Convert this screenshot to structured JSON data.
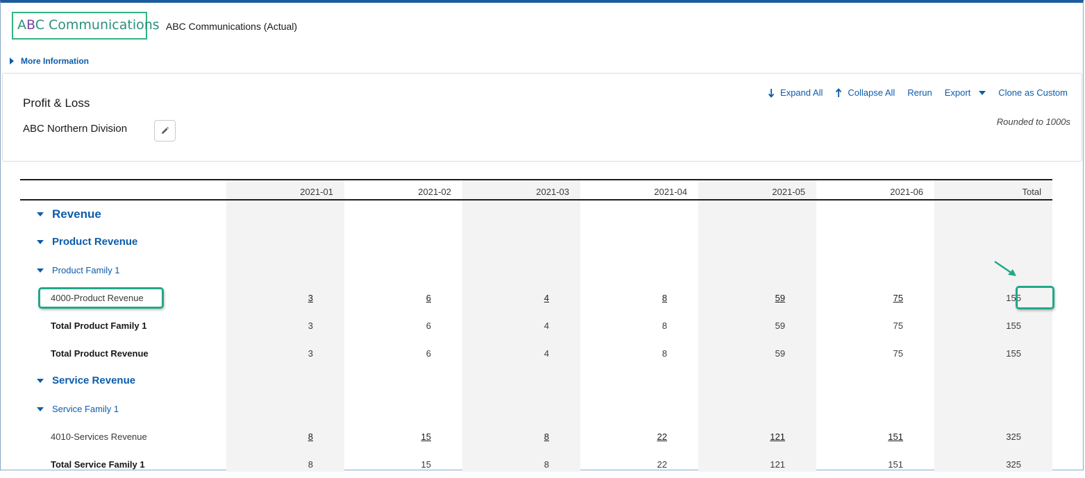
{
  "header": {
    "logo_text": "ABC Communications",
    "company_title": "ABC Communications (Actual)",
    "more_info": "More Information"
  },
  "report": {
    "title": "Profit & Loss",
    "subtitle": "ABC Northern Division",
    "rounded_note": "Rounded to 1000s",
    "actions": {
      "expand_all": "Expand All",
      "collapse_all": "Collapse All",
      "rerun": "Rerun",
      "export": "Export",
      "clone": "Clone as Custom"
    }
  },
  "table": {
    "columns": [
      "2021-01",
      "2021-02",
      "2021-03",
      "2021-04",
      "2021-05",
      "2021-06",
      "Total"
    ],
    "rows": [
      {
        "label": "Revenue",
        "level": "lvl0",
        "values": []
      },
      {
        "label": "Product Revenue",
        "level": "lvl1",
        "values": []
      },
      {
        "label": "Product Family 1",
        "level": "lvl2",
        "values": []
      },
      {
        "label": "4000-Product Revenue",
        "level": "acct",
        "values": [
          "3",
          "6",
          "4",
          "8",
          "59",
          "75",
          "155"
        ]
      },
      {
        "label": "Total Product Family 1",
        "level": "tot",
        "values": [
          "3",
          "6",
          "4",
          "8",
          "59",
          "75",
          "155"
        ]
      },
      {
        "label": "Total Product Revenue",
        "level": "tot",
        "values": [
          "3",
          "6",
          "4",
          "8",
          "59",
          "75",
          "155"
        ]
      },
      {
        "label": "Service Revenue",
        "level": "lvl1",
        "values": []
      },
      {
        "label": "Service Family 1",
        "level": "lvl2",
        "values": []
      },
      {
        "label": "4010-Services Revenue",
        "level": "acct",
        "values": [
          "8",
          "15",
          "8",
          "22",
          "121",
          "151",
          "325"
        ]
      },
      {
        "label": "Total Service Family 1",
        "level": "tot",
        "values": [
          "8",
          "15",
          "8",
          "22",
          "121",
          "151",
          "325"
        ]
      }
    ]
  },
  "colors": {
    "link": "#0b5cab",
    "highlight": "#21a88a",
    "logo_border": "#2fb57e"
  }
}
